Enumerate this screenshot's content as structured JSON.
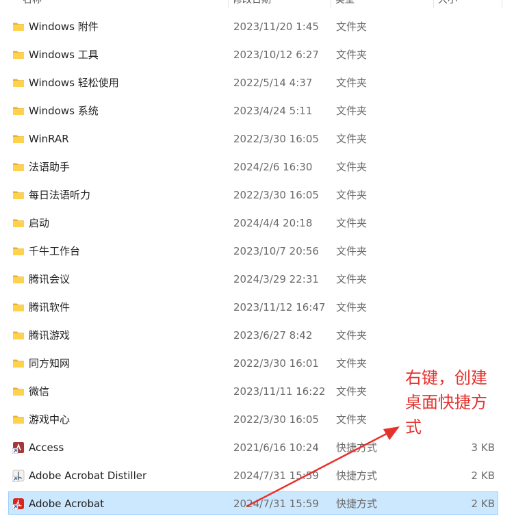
{
  "columns": {
    "name": "名称",
    "date": "修改日期",
    "type": "类型",
    "size": "大小"
  },
  "rows": [
    {
      "name": "Windows 附件",
      "date": "2023/11/20 1:45",
      "type": "文件夹",
      "size": "",
      "icon": "folder-icon"
    },
    {
      "name": "Windows 工具",
      "date": "2023/10/12 6:27",
      "type": "文件夹",
      "size": "",
      "icon": "folder-icon"
    },
    {
      "name": "Windows 轻松使用",
      "date": "2022/5/14 4:37",
      "type": "文件夹",
      "size": "",
      "icon": "folder-icon"
    },
    {
      "name": "Windows 系统",
      "date": "2023/4/24 5:11",
      "type": "文件夹",
      "size": "",
      "icon": "folder-icon"
    },
    {
      "name": "WinRAR",
      "date": "2022/3/30 16:05",
      "type": "文件夹",
      "size": "",
      "icon": "folder-icon"
    },
    {
      "name": "法语助手",
      "date": "2024/2/6 16:30",
      "type": "文件夹",
      "size": "",
      "icon": "folder-icon"
    },
    {
      "name": "每日法语听力",
      "date": "2022/3/30 16:05",
      "type": "文件夹",
      "size": "",
      "icon": "folder-icon"
    },
    {
      "name": "启动",
      "date": "2024/4/4 20:18",
      "type": "文件夹",
      "size": "",
      "icon": "folder-icon"
    },
    {
      "name": "千牛工作台",
      "date": "2023/10/7 20:56",
      "type": "文件夹",
      "size": "",
      "icon": "folder-icon"
    },
    {
      "name": "腾讯会议",
      "date": "2024/3/29 22:31",
      "type": "文件夹",
      "size": "",
      "icon": "folder-icon"
    },
    {
      "name": "腾讯软件",
      "date": "2023/11/12 16:47",
      "type": "文件夹",
      "size": "",
      "icon": "folder-icon"
    },
    {
      "name": "腾讯游戏",
      "date": "2023/6/27 8:42",
      "type": "文件夹",
      "size": "",
      "icon": "folder-icon"
    },
    {
      "name": "同方知网",
      "date": "2022/3/30 16:01",
      "type": "文件夹",
      "size": "",
      "icon": "folder-icon"
    },
    {
      "name": "微信",
      "date": "2023/11/11 16:22",
      "type": "文件夹",
      "size": "",
      "icon": "folder-icon"
    },
    {
      "name": "游戏中心",
      "date": "2022/3/30 16:05",
      "type": "文件夹",
      "size": "",
      "icon": "folder-icon"
    },
    {
      "name": "Access",
      "date": "2021/6/16 10:24",
      "type": "快捷方式",
      "size": "3 KB",
      "icon": "access-shortcut-icon"
    },
    {
      "name": "Adobe Acrobat Distiller",
      "date": "2024/7/31 15:59",
      "type": "快捷方式",
      "size": "2 KB",
      "icon": "acrobat-distiller-shortcut-icon"
    },
    {
      "name": "Adobe Acrobat",
      "date": "2024/7/31 15:59",
      "type": "快捷方式",
      "size": "2 KB",
      "icon": "acrobat-shortcut-icon",
      "selected": true
    }
  ],
  "annotation": {
    "lines": [
      "右键，创建",
      "桌面快捷方",
      "式"
    ],
    "color": "#e5322d"
  },
  "colors": {
    "folder": "#f5c542",
    "selection_bg": "#cce8ff",
    "selection_border": "#99d1ff"
  }
}
